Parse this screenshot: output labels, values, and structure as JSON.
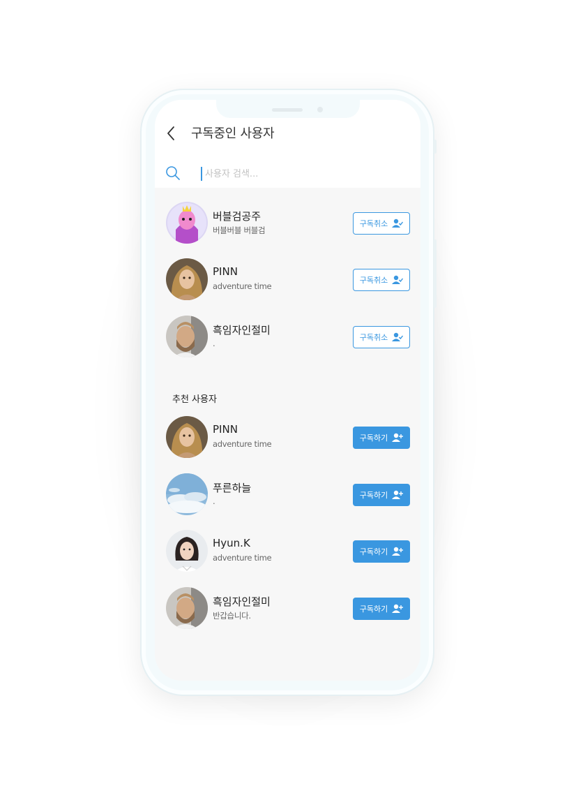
{
  "header": {
    "title": "구독중인 사용자",
    "back_icon": "chevron-left-icon"
  },
  "search": {
    "placeholder": "사용자 검색...",
    "icon": "search-icon"
  },
  "subscribed": {
    "users": [
      {
        "name": "버블검공주",
        "subtitle": "버블버블 버블검",
        "button": "구독취소",
        "avatar": "princess"
      },
      {
        "name": "PINN",
        "subtitle": "adventure time",
        "button": "구독취소",
        "avatar": "woman-blonde"
      },
      {
        "name": "흑임자인절미",
        "subtitle": ".",
        "button": "구독취소",
        "avatar": "man-bearded"
      }
    ]
  },
  "recommended": {
    "title": "추천 사용자",
    "users": [
      {
        "name": "PINN",
        "subtitle": "adventure time",
        "button": "구독하기",
        "avatar": "woman-blonde"
      },
      {
        "name": "푸른하늘",
        "subtitle": ".",
        "button": "구독하기",
        "avatar": "sky"
      },
      {
        "name": "Hyun.K",
        "subtitle": "adventure time",
        "button": "구독하기",
        "avatar": "woman-dark"
      },
      {
        "name": "흑임자인절미",
        "subtitle": "반갑습니다.",
        "button": "구독하기",
        "avatar": "man-bearded"
      }
    ]
  },
  "colors": {
    "accent": "#3a97e0",
    "background": "#f7f7f7"
  }
}
